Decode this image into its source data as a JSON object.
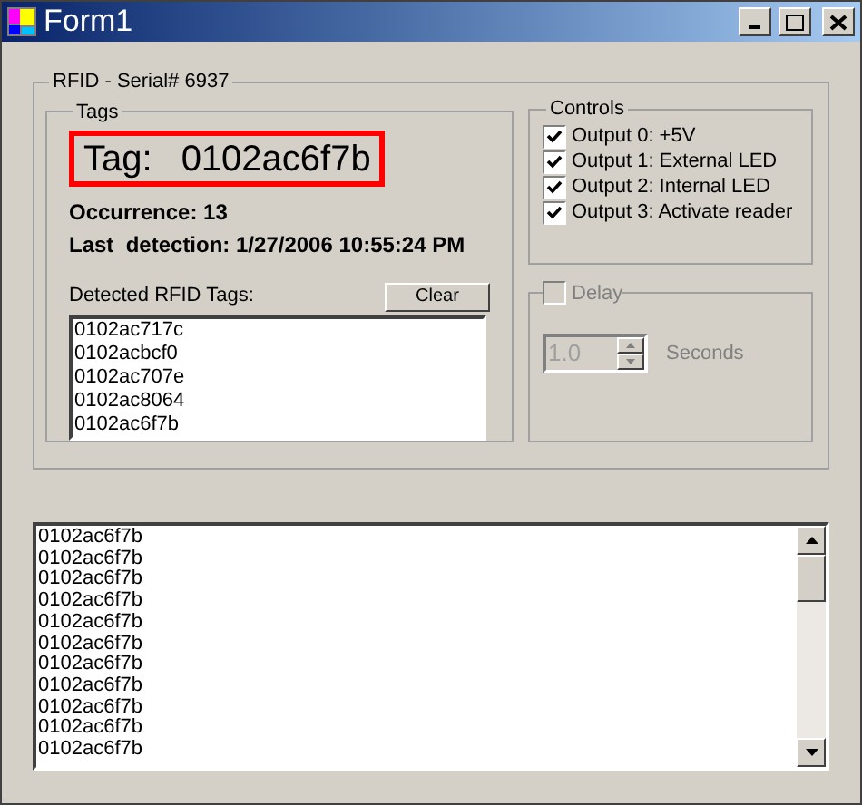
{
  "window": {
    "title": "Form1"
  },
  "rfid_group": {
    "title": "RFID - Serial# 6937",
    "tags_group": {
      "title": "Tags",
      "tag_label": "Tag:",
      "tag_value": "0102ac6f7b",
      "occurrence": "Occurrence: 13",
      "last_detection": "Last  detection: 1/27/2006 10:55:24 PM",
      "detected_label": "Detected RFID Tags:",
      "clear_button": "Clear",
      "detected_tags": [
        "0102ac717c",
        "0102acbcf0",
        "0102ac707e",
        "0102ac8064",
        "0102ac6f7b"
      ]
    },
    "controls_group": {
      "title": "Controls",
      "outputs": [
        {
          "label": "Output 0: +5V",
          "checked": true
        },
        {
          "label": "Output 1: External LED",
          "checked": true
        },
        {
          "label": "Output 2: Internal LED",
          "checked": true
        },
        {
          "label": "Output 3: Activate reader",
          "checked": true
        }
      ]
    },
    "delay_group": {
      "title": "Delay",
      "checked": false,
      "value": "1.0",
      "disabled": true,
      "unit": "Seconds"
    }
  },
  "log": [
    "0102ac6f7b",
    "0102ac6f7b",
    "0102ac6f7b",
    "0102ac6f7b",
    "0102ac6f7b",
    "0102ac6f7b",
    "0102ac6f7b",
    "0102ac6f7b",
    "0102ac6f7b",
    "0102ac6f7b",
    "0102ac6f7b"
  ]
}
